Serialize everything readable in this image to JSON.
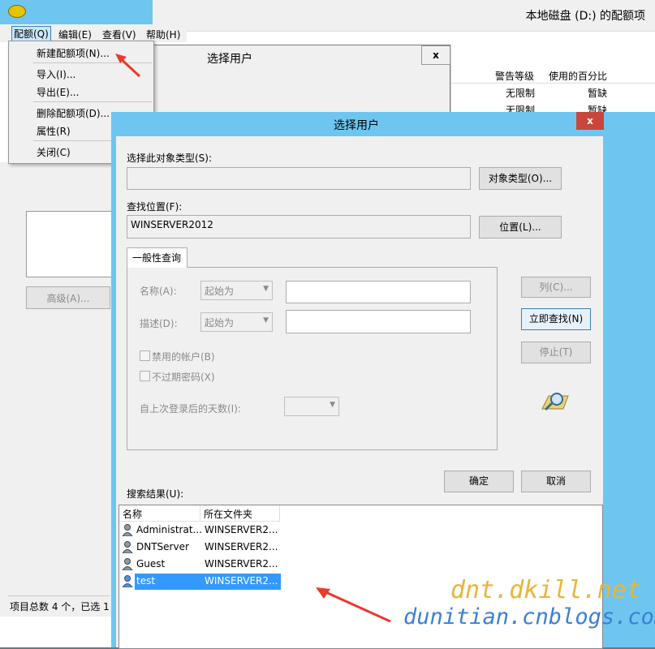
{
  "window": {
    "title": "本地磁盘 (D:) 的配额项"
  },
  "menubar": {
    "items": [
      "配额(Q)",
      "编辑(E)",
      "查看(V)",
      "帮助(H)"
    ]
  },
  "quota_menu": {
    "items": [
      "新建配额项(N)...",
      "导入(I)...",
      "导出(E)...",
      "删除配额项(D)...",
      "属性(R)",
      "关闭(C)"
    ]
  },
  "back_table": {
    "headers": [
      "警告等级",
      "使用的百分比"
    ],
    "rows": [
      [
        "无限制",
        "暂缺"
      ],
      [
        "无限制",
        "暂缺"
      ]
    ]
  },
  "left_panel": {
    "advanced_button": "高级(A)..."
  },
  "status": {
    "text": "项目总数 4 个，已选 1"
  },
  "dialog_back": {
    "title": "选择用户",
    "close": "x"
  },
  "dialog": {
    "title": "选择用户",
    "close": "x",
    "object_type_label": "选择此对象类型(S):",
    "object_type_value": "",
    "object_type_button": "对象类型(O)...",
    "location_label": "查找位置(F):",
    "location_value": "WINSERVER2012",
    "location_button": "位置(L)...",
    "tab_general": "一般性查询",
    "name_label": "名称(A):",
    "name_mode": "起始为",
    "desc_label": "描述(D):",
    "desc_mode": "起始为",
    "disabled_accounts": "禁用的帐户(B)",
    "non_expiring": "不过期密码(X)",
    "days_since_login": "自上次登录后的天数(I):",
    "columns_button": "列(C)...",
    "find_now_button": "立即查找(N)",
    "stop_button": "停止(T)",
    "ok_button": "确定",
    "cancel_button": "取消",
    "results_label": "搜索结果(U):",
    "results_headers": [
      "名称",
      "所在文件夹"
    ],
    "results": [
      {
        "name": "Administrat...",
        "folder": "WINSERVER2..."
      },
      {
        "name": "DNTServer",
        "folder": "WINSERVER2..."
      },
      {
        "name": "Guest",
        "folder": "WINSERVER2..."
      },
      {
        "name": "test",
        "folder": "WINSERVER2..."
      }
    ]
  },
  "watermark": {
    "line1": "dnt.dkill.net",
    "line2": "dunitian.cnblogs.com"
  },
  "colors": {
    "titlebar": "#6ec6f0",
    "selection": "#3399ff",
    "arrow": "#e83a2e"
  }
}
